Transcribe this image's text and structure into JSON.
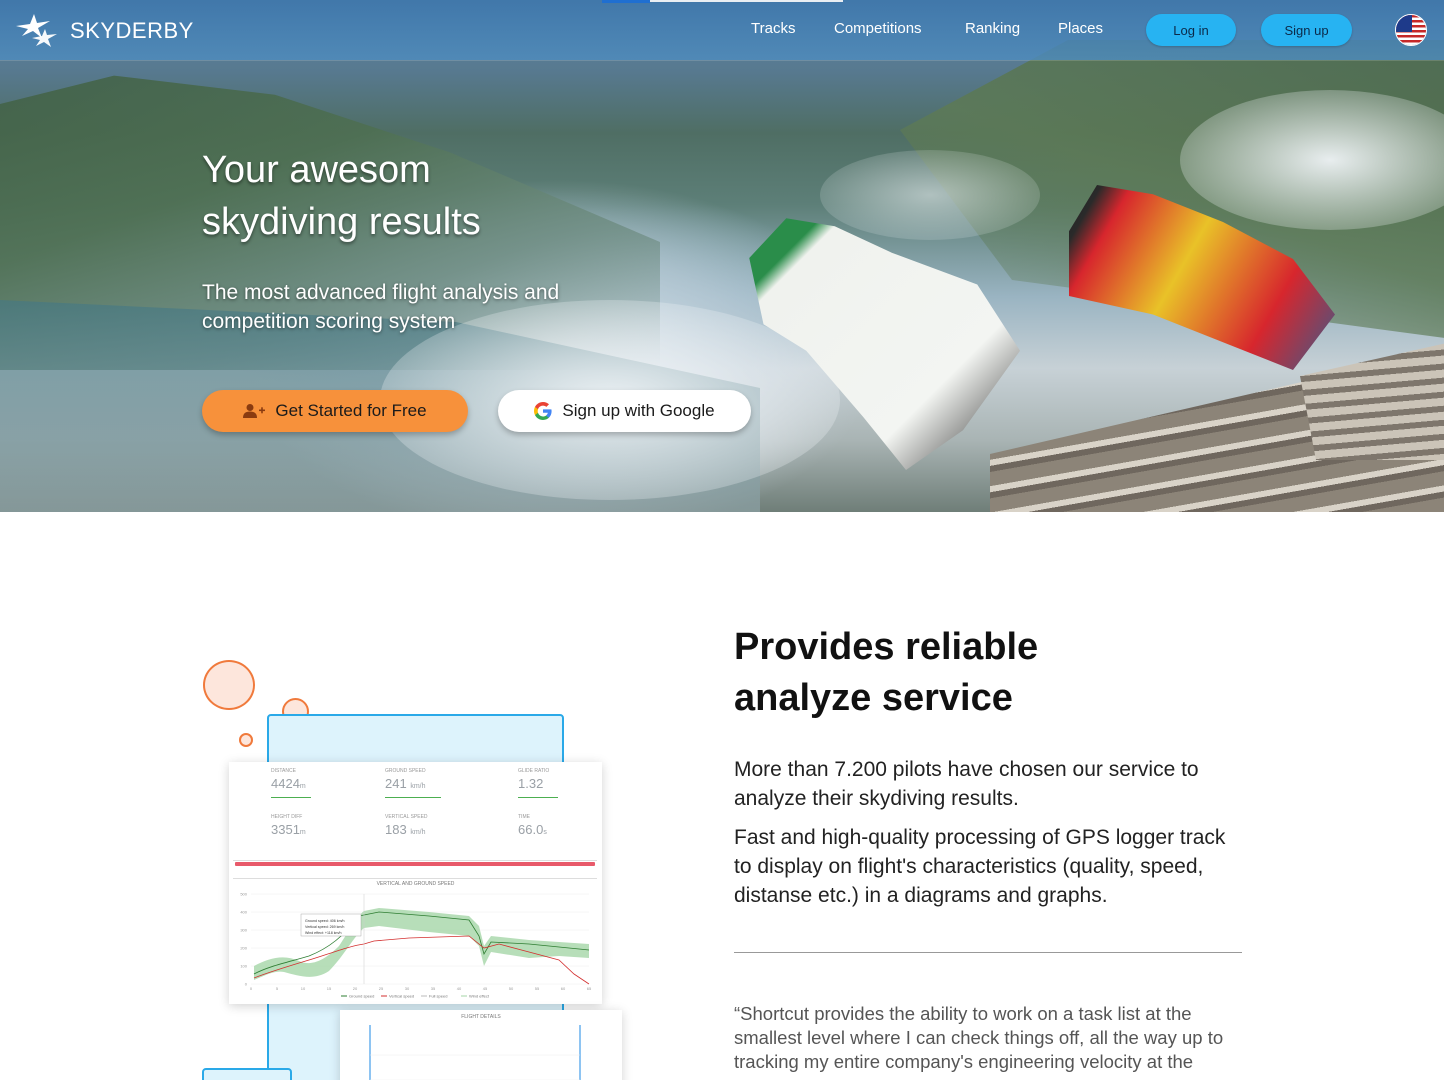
{
  "brand": {
    "name": "SKYDERBY"
  },
  "nav": {
    "links": [
      "Tracks",
      "Competitions",
      "Ranking",
      "Places"
    ],
    "login": "Log in",
    "signup": "Sign up",
    "language_icon": "us-flag-icon"
  },
  "hero": {
    "title_line1": "Your awesom",
    "title_line2": "skydiving results",
    "subtitle": "The most advanced flight analysis and competition scoring system",
    "cta_primary": "Get Started for Free",
    "cta_google": "Sign up with Google"
  },
  "section": {
    "title_line1": "Provides reliable",
    "title_line2": "analyze service",
    "p1": "More than 7.200 pilots have chosen our service to analyze their skydiving results.",
    "p2": "Fast and high-quality processing of GPS logger track to display on flight's characteristics (quality, speed, distanse etc.) in a diagrams and graphs.",
    "quote": "“Shortcut provides the ability to work on a task list at the smallest level where I can check things off, all the way up to tracking my entire company's engineering velocity at the"
  },
  "illustration": {
    "stats": [
      {
        "label": "Distance",
        "value": "4424",
        "unit": "m"
      },
      {
        "label": "Ground speed",
        "value": "241",
        "unit": "km/h"
      },
      {
        "label": "Glide ratio",
        "value": "1.32",
        "unit": ""
      },
      {
        "label": "Height diff",
        "value": "3351",
        "unit": "m"
      },
      {
        "label": "Vertical speed",
        "value": "183",
        "unit": "km/h"
      },
      {
        "label": "Time",
        "value": "66.0",
        "unit": "s"
      }
    ],
    "chart_title": "VERTICAL AND GROUND SPEED",
    "chart2_title": "FLIGHT DETAILS",
    "tooltip": [
      "Ground speed: 406 km/h",
      "Vertical speed: 269 km/h",
      "Wind effect: +118 km/h"
    ],
    "legend": [
      "Ground speed",
      "Vertical speed",
      "Full speed",
      "Wind effect"
    ],
    "y_ticks": [
      "500",
      "400",
      "300",
      "200",
      "100",
      "0"
    ],
    "x_ticks": [
      "0",
      "5",
      "10",
      "15",
      "20",
      "25",
      "30",
      "35",
      "40",
      "45",
      "50",
      "55",
      "60",
      "65"
    ],
    "colors": {
      "ground": "#2e7d32",
      "vertical": "#d32f2f",
      "wind": "#a5d6a7"
    }
  }
}
